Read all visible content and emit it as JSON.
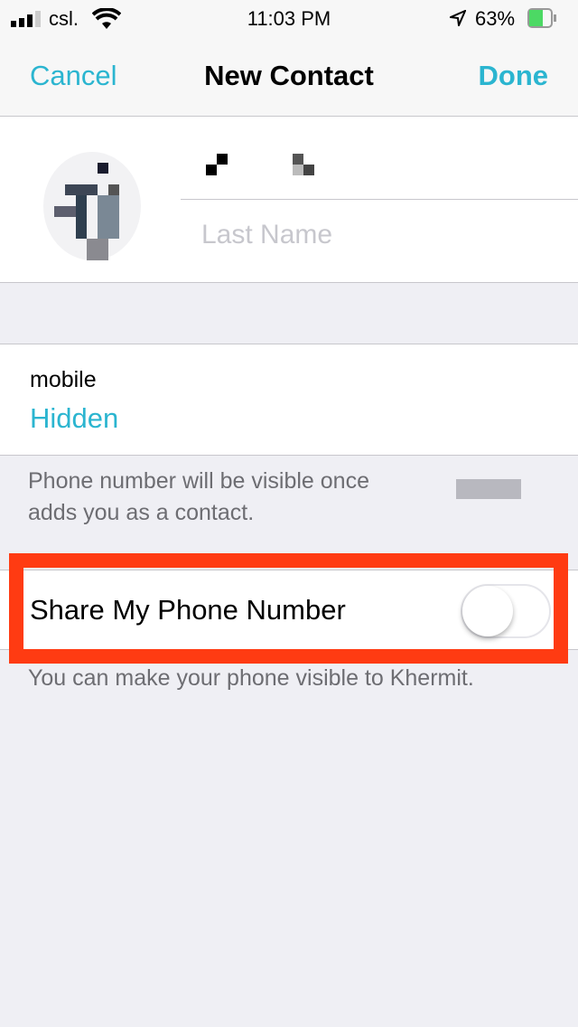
{
  "status_bar": {
    "carrier": "csl.",
    "time": "11:03 PM",
    "battery": "63%",
    "battery_level": 0.63,
    "charging": true
  },
  "nav": {
    "cancel": "Cancel",
    "title": "New Contact",
    "done": "Done"
  },
  "contact": {
    "last_name_placeholder": "Last Name"
  },
  "phone": {
    "label": "mobile",
    "value": "Hidden",
    "note_line1": "Phone number will be visible once",
    "note_line2": "adds you as a contact."
  },
  "share": {
    "label": "Share My Phone Number",
    "enabled": false,
    "note": "You can make your phone visible to Khermit."
  },
  "colors": {
    "accent": "#2bb5d0",
    "highlight": "#ff3b12",
    "background": "#efeff4"
  }
}
